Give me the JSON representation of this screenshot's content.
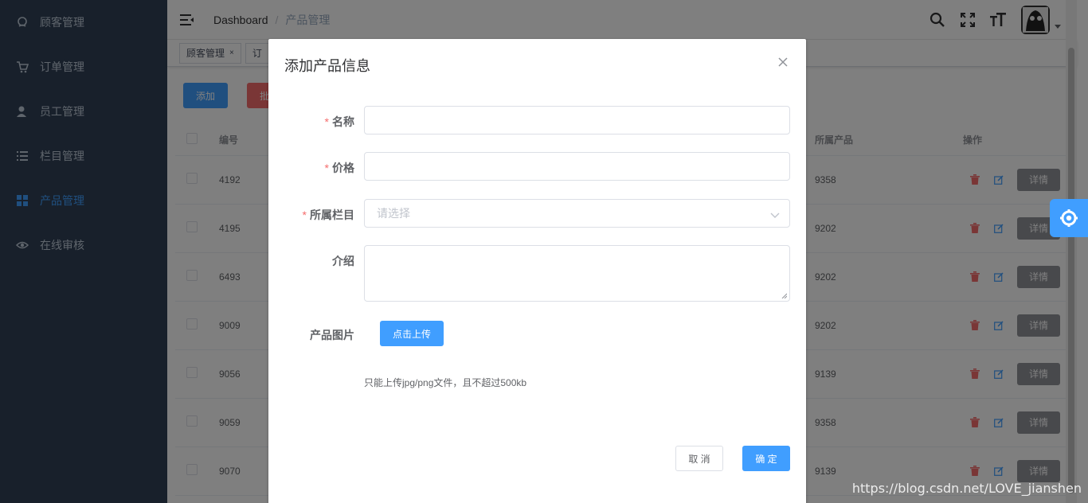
{
  "sidebar": {
    "items": [
      {
        "label": "顾客管理",
        "icon": "customer-icon"
      },
      {
        "label": "订单管理",
        "icon": "cart-icon"
      },
      {
        "label": "员工管理",
        "icon": "employee-icon"
      },
      {
        "label": "栏目管理",
        "icon": "list-icon"
      },
      {
        "label": "产品管理",
        "icon": "grid-icon",
        "active": true
      },
      {
        "label": "在线审核",
        "icon": "eye-icon"
      }
    ]
  },
  "navbar": {
    "breadcrumb": [
      "Dashboard",
      "产品管理"
    ]
  },
  "tags": [
    {
      "label": "顾客管理",
      "close": "×"
    },
    {
      "label": "订"
    }
  ],
  "toolbar": {
    "add_label": "添加",
    "batch_label": "批"
  },
  "table": {
    "headers": {
      "id": "编号",
      "product": "所属产品",
      "ops": "操作"
    },
    "detail_label": "详情",
    "rows": [
      {
        "id": "4192",
        "product": "9358"
      },
      {
        "id": "4195",
        "product": "9202"
      },
      {
        "id": "6493",
        "product": "9202"
      },
      {
        "id": "9009",
        "product": "9202"
      },
      {
        "id": "9056",
        "product": "9139"
      },
      {
        "id": "9059",
        "product": "9358"
      },
      {
        "id": "9070",
        "product": "9139"
      }
    ]
  },
  "dialog": {
    "title": "添加产品信息",
    "fields": {
      "name_label": "名称",
      "price_label": "价格",
      "category_label": "所属栏目",
      "category_placeholder": "请选择",
      "intro_label": "介绍",
      "image_label": "产品图片"
    },
    "required_mark": "*",
    "upload_label": "点击上传",
    "upload_tip": "只能上传jpg/png文件，且不超过500kb",
    "cancel_label": "取 消",
    "ok_label": "确 定"
  },
  "watermark": "https://blog.csdn.net/LOVE_jianshen",
  "colors": {
    "primary": "#409eff",
    "sidebar": "#304156",
    "danger": "#f56c6c"
  }
}
